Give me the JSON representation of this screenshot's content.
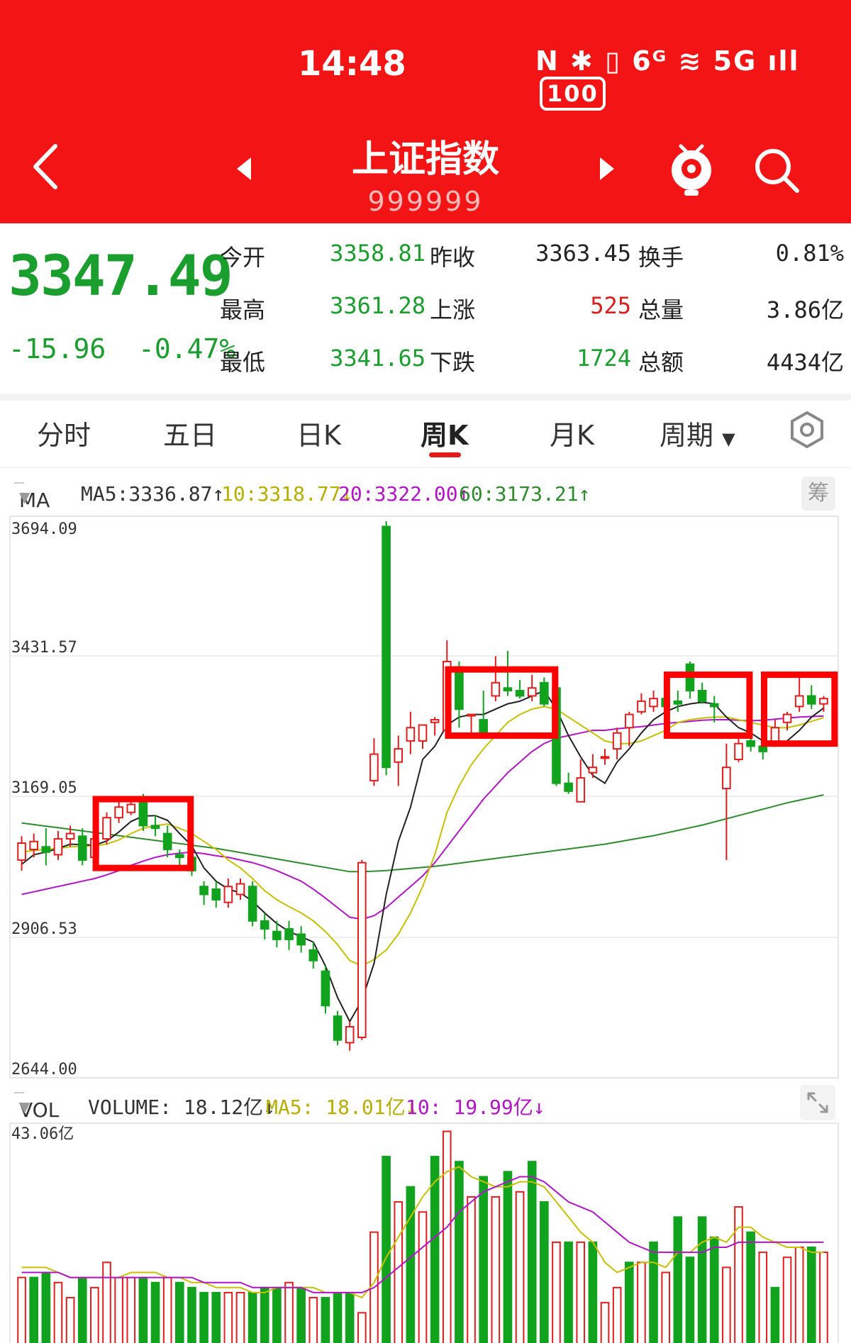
{
  "status_bar": {
    "time": "14:48",
    "icons": "N ✱ ▯ 6ᴳ ≋ 5G ıll",
    "battery": "100"
  },
  "header": {
    "title": "上证指数",
    "code": "999999"
  },
  "quote": {
    "price": "3347.49",
    "change": "-15.96",
    "change_pct": "-0.47%",
    "rows": [
      {
        "l1": "今开",
        "v1": "3358.81",
        "l2": "昨收",
        "v2": "3363.45",
        "l3": "换手",
        "v3": "0.81%"
      },
      {
        "l1": "最高",
        "v1": "3361.28",
        "l2": "上涨",
        "v2": "525",
        "l3": "总量",
        "v3": "3.86亿"
      },
      {
        "l1": "最低",
        "v1": "3341.65",
        "l2": "下跌",
        "v2": "1724",
        "l3": "总额",
        "v3": "4434亿"
      }
    ]
  },
  "tabs": [
    "分时",
    "五日",
    "日K",
    "周K",
    "月K",
    "周期"
  ],
  "active_tab": "周K",
  "ma_legend": {
    "selector": "MA",
    "ma5": "MA5:3336.87↑",
    "ma10": "10:3318.77↓",
    "ma20": "20:3322.00↑",
    "ma60": "60:3173.21↑",
    "chip_button": "筹"
  },
  "kline_axis": {
    "labels": [
      "3694.09",
      "3431.57",
      "3169.05",
      "2906.53",
      "2644.00"
    ]
  },
  "vol_legend": {
    "selector": "VOL",
    "volume": "VOLUME: 18.12亿↓",
    "ma5": "MA5: 18.01亿↓",
    "ma10": "10: 19.99亿↓"
  },
  "vol_axis": {
    "max_label": "43.06亿"
  },
  "colors": {
    "up": "#e11d1d",
    "down": "#12a31e",
    "ma5": "#222222",
    "ma10": "#c8c000",
    "ma20": "#b414c8",
    "ma60": "#2e8b2e",
    "highlight": "#ff0000",
    "header": "#f31515"
  },
  "chart_data": {
    "type": "candlestick",
    "y_range": [
      2644.0,
      3694.09
    ],
    "candles": [
      {
        "o": 3050,
        "c": 3082,
        "h": 3095,
        "l": 3030
      },
      {
        "o": 3070,
        "c": 3085,
        "h": 3100,
        "l": 3055
      },
      {
        "o": 3075,
        "c": 3065,
        "h": 3110,
        "l": 3040
      },
      {
        "o": 3060,
        "c": 3090,
        "h": 3105,
        "l": 3050
      },
      {
        "o": 3090,
        "c": 3100,
        "h": 3115,
        "l": 3075
      },
      {
        "o": 3095,
        "c": 3050,
        "h": 3110,
        "l": 3040
      },
      {
        "o": 3055,
        "c": 3090,
        "h": 3105,
        "l": 3045
      },
      {
        "o": 3090,
        "c": 3130,
        "h": 3140,
        "l": 3080
      },
      {
        "o": 3130,
        "c": 3150,
        "h": 3165,
        "l": 3120
      },
      {
        "o": 3140,
        "c": 3155,
        "h": 3165,
        "l": 3135
      },
      {
        "o": 3160,
        "c": 3115,
        "h": 3175,
        "l": 3105
      },
      {
        "o": 3115,
        "c": 3110,
        "h": 3135,
        "l": 3095
      },
      {
        "o": 3100,
        "c": 3070,
        "h": 3115,
        "l": 3055
      },
      {
        "o": 3060,
        "c": 3055,
        "h": 3070,
        "l": 3040
      },
      {
        "o": 3055,
        "c": 3030,
        "h": 3065,
        "l": 3020
      },
      {
        "o": 3000,
        "c": 2985,
        "h": 3010,
        "l": 2965
      },
      {
        "o": 2995,
        "c": 2975,
        "h": 3010,
        "l": 2960
      },
      {
        "o": 2970,
        "c": 3000,
        "h": 3015,
        "l": 2960
      },
      {
        "o": 2985,
        "c": 3005,
        "h": 3015,
        "l": 2975
      },
      {
        "o": 3000,
        "c": 2935,
        "h": 3010,
        "l": 2925
      },
      {
        "o": 2935,
        "c": 2920,
        "h": 2950,
        "l": 2900
      },
      {
        "o": 2915,
        "c": 2900,
        "h": 2935,
        "l": 2885
      },
      {
        "o": 2920,
        "c": 2900,
        "h": 2935,
        "l": 2880
      },
      {
        "o": 2910,
        "c": 2890,
        "h": 2925,
        "l": 2875
      },
      {
        "o": 2880,
        "c": 2860,
        "h": 2895,
        "l": 2845
      },
      {
        "o": 2840,
        "c": 2775,
        "h": 2850,
        "l": 2760
      },
      {
        "o": 2755,
        "c": 2710,
        "h": 2765,
        "l": 2700
      },
      {
        "o": 2705,
        "c": 2735,
        "h": 2745,
        "l": 2690
      },
      {
        "o": 2715,
        "c": 3045,
        "h": 3050,
        "l": 2710
      },
      {
        "o": 3200,
        "c": 3250,
        "h": 3280,
        "l": 3190
      },
      {
        "o": 3680,
        "c": 3225,
        "h": 3690,
        "l": 3210
      },
      {
        "o": 3235,
        "c": 3260,
        "h": 3285,
        "l": 3190
      },
      {
        "o": 3275,
        "c": 3300,
        "h": 3330,
        "l": 3250
      },
      {
        "o": 3275,
        "c": 3305,
        "h": 3305,
        "l": 3260
      },
      {
        "o": 3310,
        "c": 3315,
        "h": 3320,
        "l": 3285
      },
      {
        "o": 3295,
        "c": 3425,
        "h": 3465,
        "l": 3285
      },
      {
        "o": 3415,
        "c": 3335,
        "h": 3425,
        "l": 3300
      },
      {
        "o": 3325,
        "c": 3325,
        "h": 3325,
        "l": 3285
      },
      {
        "o": 3315,
        "c": 3285,
        "h": 3370,
        "l": 3280
      },
      {
        "o": 3360,
        "c": 3385,
        "h": 3435,
        "l": 3350
      },
      {
        "o": 3375,
        "c": 3370,
        "h": 3445,
        "l": 3360
      },
      {
        "o": 3370,
        "c": 3360,
        "h": 3390,
        "l": 3355
      },
      {
        "o": 3360,
        "c": 3375,
        "h": 3400,
        "l": 3350
      },
      {
        "o": 3385,
        "c": 3345,
        "h": 3395,
        "l": 3340
      },
      {
        "o": 3375,
        "c": 3195,
        "h": 3380,
        "l": 3190
      },
      {
        "o": 3195,
        "c": 3180,
        "h": 3215,
        "l": 3175
      },
      {
        "o": 3160,
        "c": 3205,
        "h": 3240,
        "l": 3160
      },
      {
        "o": 3215,
        "c": 3225,
        "h": 3250,
        "l": 3205
      },
      {
        "o": 3245,
        "c": 3245,
        "h": 3260,
        "l": 3230
      },
      {
        "o": 3260,
        "c": 3290,
        "h": 3300,
        "l": 3240
      },
      {
        "o": 3300,
        "c": 3325,
        "h": 3330,
        "l": 3265
      },
      {
        "o": 3330,
        "c": 3350,
        "h": 3365,
        "l": 3325
      },
      {
        "o": 3340,
        "c": 3355,
        "h": 3370,
        "l": 3330
      },
      {
        "o": 3355,
        "c": 3340,
        "h": 3375,
        "l": 3325
      },
      {
        "o": 3350,
        "c": 3345,
        "h": 3370,
        "l": 3330
      },
      {
        "o": 3420,
        "c": 3370,
        "h": 3425,
        "l": 3355
      },
      {
        "o": 3370,
        "c": 3350,
        "h": 3385,
        "l": 3345
      },
      {
        "o": 3345,
        "c": 3340,
        "h": 3360,
        "l": 3310
      },
      {
        "o": 3185,
        "c": 3225,
        "h": 3270,
        "l": 3050
      },
      {
        "o": 3240,
        "c": 3270,
        "h": 3290,
        "l": 3235
      },
      {
        "o": 3275,
        "c": 3265,
        "h": 3285,
        "l": 3255
      },
      {
        "o": 3265,
        "c": 3255,
        "h": 3275,
        "l": 3240
      },
      {
        "o": 3270,
        "c": 3300,
        "h": 3315,
        "l": 3270
      },
      {
        "o": 3310,
        "c": 3325,
        "h": 3330,
        "l": 3295
      },
      {
        "o": 3340,
        "c": 3360,
        "h": 3395,
        "l": 3330
      },
      {
        "o": 3360,
        "c": 3345,
        "h": 3380,
        "l": 3335
      },
      {
        "o": 3345,
        "c": 3355,
        "h": 3360,
        "l": 3330
      }
    ],
    "ma5": [
      3042,
      3060,
      3065,
      3072,
      3080,
      3079,
      3078,
      3086,
      3103,
      3123,
      3133,
      3134,
      3125,
      3100,
      3077,
      3035,
      3010,
      2995,
      2988,
      2972,
      2950,
      2930,
      2915,
      2905,
      2895,
      2850,
      2790,
      2745,
      2785,
      2855,
      2985,
      3085,
      3150,
      3240,
      3265,
      3305,
      3320,
      3325,
      3325,
      3335,
      3345,
      3350,
      3360,
      3370,
      3335,
      3285,
      3245,
      3210,
      3195,
      3235,
      3260,
      3290,
      3315,
      3330,
      3340,
      3345,
      3348,
      3345,
      3320,
      3300,
      3290,
      3275,
      3265,
      3275,
      3295,
      3320,
      3337
    ],
    "ma10": [
      3065,
      3068,
      3070,
      3072,
      3075,
      3076,
      3077,
      3080,
      3088,
      3100,
      3110,
      3115,
      3118,
      3110,
      3100,
      3085,
      3070,
      3050,
      3035,
      3015,
      2992,
      2975,
      2962,
      2950,
      2935,
      2915,
      2890,
      2860,
      2850,
      2862,
      2880,
      2910,
      2950,
      3000,
      3060,
      3140,
      3190,
      3230,
      3260,
      3285,
      3310,
      3325,
      3335,
      3340,
      3335,
      3320,
      3305,
      3290,
      3275,
      3270,
      3270,
      3275,
      3285,
      3295,
      3310,
      3315,
      3318,
      3320,
      3320,
      3315,
      3310,
      3305,
      3300,
      3300,
      3305,
      3312,
      3319
    ],
    "ma20": [
      2985,
      2990,
      2995,
      3000,
      3005,
      3010,
      3015,
      3022,
      3030,
      3040,
      3048,
      3055,
      3060,
      3063,
      3065,
      3062,
      3058,
      3055,
      3050,
      3045,
      3038,
      3030,
      3020,
      3010,
      2995,
      2978,
      2960,
      2942,
      2938,
      2945,
      2960,
      2980,
      3000,
      3020,
      3045,
      3075,
      3105,
      3135,
      3165,
      3190,
      3215,
      3235,
      3255,
      3270,
      3280,
      3285,
      3290,
      3295,
      3295,
      3298,
      3300,
      3302,
      3305,
      3308,
      3310,
      3312,
      3314,
      3315,
      3315,
      3314,
      3313,
      3314,
      3316,
      3318,
      3320,
      3321,
      3322
    ],
    "ma60": [
      3120,
      3117,
      3114,
      3111,
      3108,
      3105,
      3102,
      3099,
      3096,
      3093,
      3090,
      3087,
      3084,
      3081,
      3078,
      3075,
      3072,
      3068,
      3064,
      3060,
      3056,
      3052,
      3048,
      3044,
      3040,
      3036,
      3032,
      3028,
      3028,
      3029,
      3030,
      3032,
      3034,
      3036,
      3038,
      3041,
      3044,
      3047,
      3050,
      3053,
      3056,
      3059,
      3062,
      3065,
      3068,
      3071,
      3074,
      3077,
      3080,
      3084,
      3088,
      3092,
      3096,
      3101,
      3106,
      3111,
      3116,
      3122,
      3128,
      3134,
      3140,
      3146,
      3152,
      3158,
      3163,
      3168,
      3173
    ],
    "volume": [
      {
        "v": 13,
        "up": true
      },
      {
        "v": 13,
        "up": false
      },
      {
        "v": 14,
        "up": false
      },
      {
        "v": 12,
        "up": true
      },
      {
        "v": 9,
        "up": true
      },
      {
        "v": 13,
        "up": false
      },
      {
        "v": 11,
        "up": true
      },
      {
        "v": 16,
        "up": true
      },
      {
        "v": 13,
        "up": true
      },
      {
        "v": 13,
        "up": true
      },
      {
        "v": 13,
        "up": false
      },
      {
        "v": 12,
        "up": false
      },
      {
        "v": 13,
        "up": true
      },
      {
        "v": 12,
        "up": false
      },
      {
        "v": 11,
        "up": false
      },
      {
        "v": 10,
        "up": false
      },
      {
        "v": 10,
        "up": false
      },
      {
        "v": 10,
        "up": true
      },
      {
        "v": 10,
        "up": true
      },
      {
        "v": 10,
        "up": false
      },
      {
        "v": 11,
        "up": false
      },
      {
        "v": 11,
        "up": false
      },
      {
        "v": 12,
        "up": true
      },
      {
        "v": 11,
        "up": false
      },
      {
        "v": 9,
        "up": true
      },
      {
        "v": 9,
        "up": false
      },
      {
        "v": 10,
        "up": false
      },
      {
        "v": 10,
        "up": false
      },
      {
        "v": 6,
        "up": true
      },
      {
        "v": 22,
        "up": true
      },
      {
        "v": 37,
        "up": false
      },
      {
        "v": 28,
        "up": true
      },
      {
        "v": 31,
        "up": false
      },
      {
        "v": 26,
        "up": true
      },
      {
        "v": 37,
        "up": false
      },
      {
        "v": 42,
        "up": true
      },
      {
        "v": 36,
        "up": false
      },
      {
        "v": 29,
        "up": true
      },
      {
        "v": 33,
        "up": false
      },
      {
        "v": 29,
        "up": true
      },
      {
        "v": 34,
        "up": false
      },
      {
        "v": 30,
        "up": true
      },
      {
        "v": 36,
        "up": false
      },
      {
        "v": 28,
        "up": false
      },
      {
        "v": 20,
        "up": true
      },
      {
        "v": 20,
        "up": false
      },
      {
        "v": 20,
        "up": true
      },
      {
        "v": 20,
        "up": false
      },
      {
        "v": 8,
        "up": true
      },
      {
        "v": 11,
        "up": true
      },
      {
        "v": 16,
        "up": false
      },
      {
        "v": 16,
        "up": true
      },
      {
        "v": 20,
        "up": false
      },
      {
        "v": 14,
        "up": true
      },
      {
        "v": 25,
        "up": false
      },
      {
        "v": 17,
        "up": false
      },
      {
        "v": 25,
        "up": false
      },
      {
        "v": 21,
        "up": false
      },
      {
        "v": 15,
        "up": true
      },
      {
        "v": 27,
        "up": true
      },
      {
        "v": 22,
        "up": false
      },
      {
        "v": 18,
        "up": true
      },
      {
        "v": 11,
        "up": false
      },
      {
        "v": 17,
        "up": true
      },
      {
        "v": 19,
        "up": true
      },
      {
        "v": 19,
        "up": false
      },
      {
        "v": 18,
        "up": true
      }
    ],
    "vol_ma5": [
      15,
      15,
      15,
      14,
      13,
      13,
      13,
      13,
      13,
      14,
      14,
      14,
      13,
      13,
      12,
      12,
      11,
      11,
      11,
      10,
      10,
      11,
      11,
      11,
      11,
      10,
      10,
      10,
      9,
      12,
      17,
      21,
      25,
      29,
      32,
      34,
      35,
      33,
      32,
      31,
      31,
      32,
      32,
      31,
      28,
      25,
      22,
      20,
      16,
      14,
      15,
      16,
      16,
      15,
      18,
      18,
      20,
      21,
      20,
      23,
      23,
      21,
      20,
      19,
      19,
      18,
      18
    ],
    "vol_ma10": [
      14,
      14,
      14,
      14,
      13,
      13,
      13,
      13,
      13,
      13,
      13,
      13,
      13,
      13,
      13,
      12,
      12,
      12,
      12,
      11,
      11,
      11,
      11,
      11,
      10,
      10,
      10,
      10,
      10,
      11,
      13,
      15,
      17,
      19,
      21,
      23,
      26,
      28,
      30,
      31,
      32,
      33,
      33,
      32,
      30,
      28,
      27,
      26,
      24,
      22,
      20,
      19,
      18,
      18,
      18,
      18,
      18,
      19,
      19,
      20,
      20,
      20,
      20,
      20,
      20,
      20,
      20
    ],
    "vol_max": 43.06,
    "highlight_boxes": [
      {
        "from": 7,
        "to": 13,
        "hi": 3165,
        "lo": 3035
      },
      {
        "from": 36,
        "to": 43,
        "hi": 3410,
        "lo": 3285
      },
      {
        "from": 54,
        "to": 59,
        "hi": 3400,
        "lo": 3285
      },
      {
        "from": 62,
        "to": 66,
        "hi": 3400,
        "lo": 3270
      }
    ]
  }
}
